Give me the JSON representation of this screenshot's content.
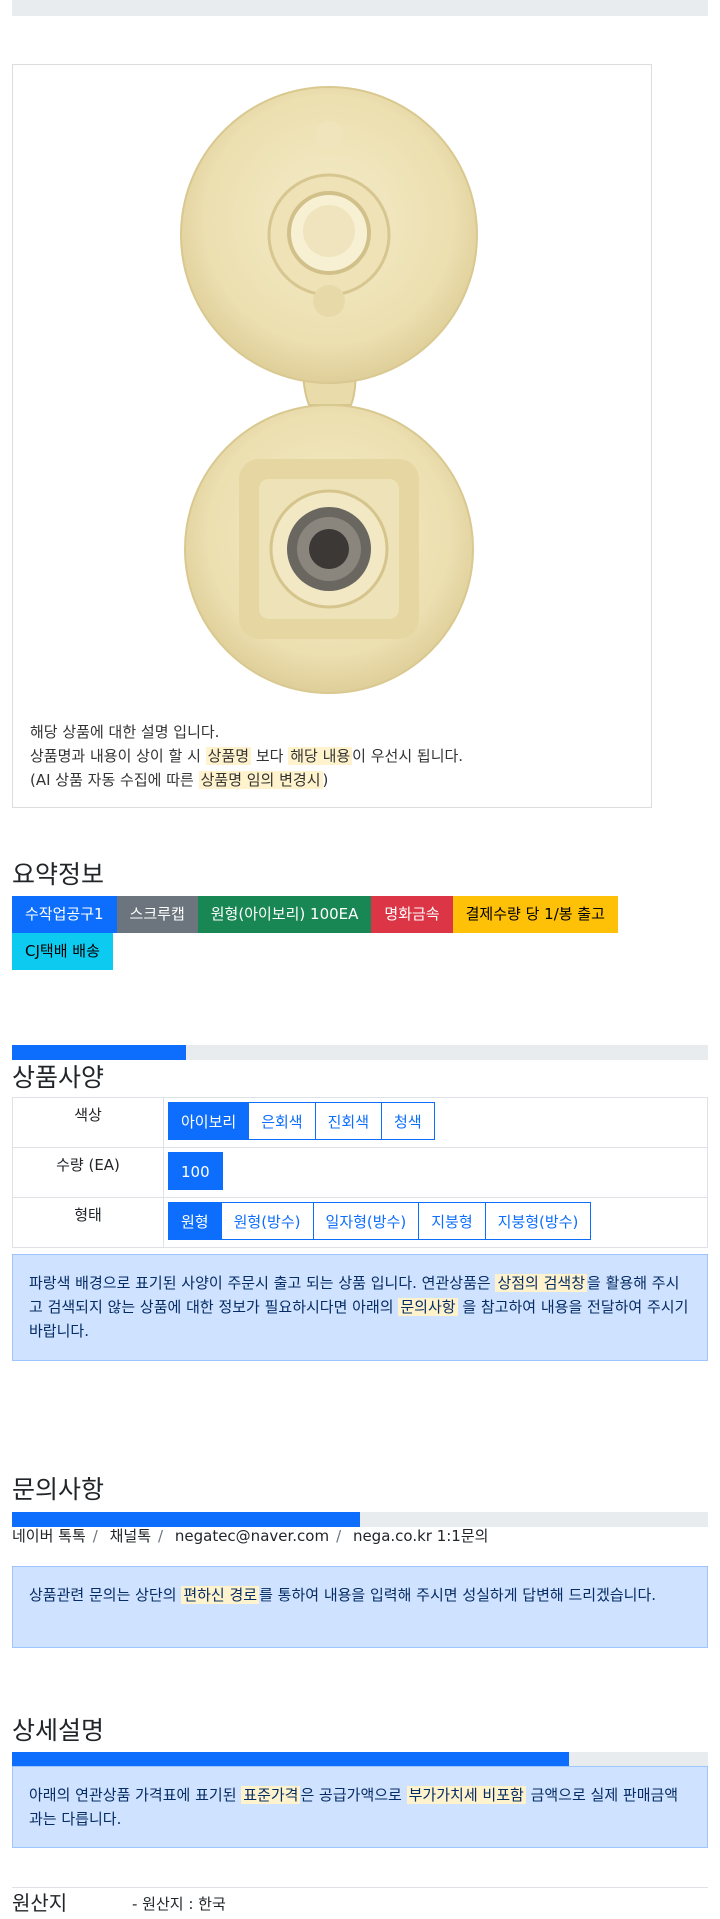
{
  "photo_card": {
    "line1": "해당 상품에 대한 설명 입니다.",
    "line2_pre": "상품명과 내용이 상이 할 시 ",
    "line2_mark1": "상품명",
    "line2_mid": " 보다 ",
    "line2_mark2": "해당 내용",
    "line2_post": "이 우선시 됩니다.",
    "line3_pre": "(AI 상품 자동 수집에 따른 ",
    "line3_mark": "상품명 임의 변경시",
    "line3_post": ")"
  },
  "summary": {
    "title": "요약정보",
    "badges": [
      {
        "label": "수작업공구1",
        "color": "#0d6efd",
        "text_color": "#ffffff"
      },
      {
        "label": "스크루캡",
        "color": "#6c757d",
        "text_color": "#ffffff"
      },
      {
        "label": "원형(아이보리) 100EA",
        "color": "#198754",
        "text_color": "#ffffff"
      },
      {
        "label": "명화금속",
        "color": "#dc3545",
        "text_color": "#ffffff"
      },
      {
        "label": "결제수량 당 1/봉 출고",
        "color": "#ffc107",
        "text_color": "#000000"
      },
      {
        "label": "CJ택배 배송",
        "color": "#0dcaf0",
        "text_color": "#000000"
      }
    ]
  },
  "spec": {
    "title": "상품사양",
    "progress": 0.25,
    "rows": [
      {
        "label": "색상",
        "options": [
          {
            "label": "아이보리",
            "selected": true
          },
          {
            "label": "은회색",
            "selected": false
          },
          {
            "label": "진회색",
            "selected": false
          },
          {
            "label": "청색",
            "selected": false
          }
        ]
      },
      {
        "label": "수량 (EA)",
        "options": [
          {
            "label": "100",
            "selected": true
          }
        ]
      },
      {
        "label": "형태",
        "options": [
          {
            "label": "원형",
            "selected": true
          },
          {
            "label": "원형(방수)",
            "selected": false
          },
          {
            "label": "일자형(방수)",
            "selected": false
          },
          {
            "label": "지붕형",
            "selected": false
          },
          {
            "label": "지붕형(방수)",
            "selected": false
          }
        ]
      }
    ],
    "note_pre": "파랑색 배경으로 표기된 사양이 주문시 출고 되는 상품 입니다. 연관상품은 ",
    "note_mark1": "상점의 검색창",
    "note_mid": "을 활용해 주시고 검색되지 않는 상품에 대한 정보가 필요하시다면 아래의 ",
    "note_mark2": "문의사항",
    "note_post": " 을 참고하여 내용을 전달하여 주시기 바랍니다."
  },
  "inquiry": {
    "title": "문의사항",
    "progress": 0.5,
    "contacts": [
      "네이버 톡톡",
      "채널톡",
      "negatec@naver.com",
      "nega.co.kr 1:1문의"
    ],
    "note_pre": "상품관련 문의는 상단의 ",
    "note_mark": "편하신 경로",
    "note_post": "를 통하여 내용을 입력해 주시면 성실하게 답변해 드리겠습니다."
  },
  "detail": {
    "title": "상세설명",
    "progress": 0.8,
    "note_pre": "아래의 연관상품 가격표에 표기된 ",
    "note_mark1": "표준가격",
    "note_mid": "은 공급가액으로 ",
    "note_mark2": "부가가치세 비포함",
    "note_post": " 금액으로 실제 판매금액과는 다릅니다."
  },
  "origin": {
    "label": "원산지",
    "value": "- 원산지 : 한국"
  }
}
